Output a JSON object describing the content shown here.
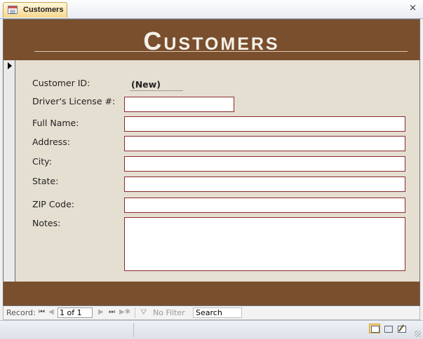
{
  "tab": {
    "label": "Customers",
    "close_glyph": "×"
  },
  "form": {
    "title": "Customers",
    "fields": [
      {
        "label": "Customer ID:",
        "value": "(New)"
      },
      {
        "label": "Driver's License #:",
        "value": ""
      },
      {
        "label": "Full Name:",
        "value": ""
      },
      {
        "label": "Address:",
        "value": ""
      },
      {
        "label": "City:",
        "value": ""
      },
      {
        "label": "State:",
        "value": ""
      },
      {
        "label": "ZIP Code:",
        "value": ""
      },
      {
        "label": "Notes:",
        "value": ""
      }
    ]
  },
  "navbar": {
    "record_label": "Record:",
    "first": "⏮",
    "prev": "◀",
    "current": "1 of 1",
    "next": "▶",
    "last": "⏭",
    "new": "▶✱",
    "filter_icon": "funnel-icon",
    "filter_label": "No Filter",
    "search_value": "Search"
  },
  "statusbar": {
    "views": [
      "form-view-icon",
      "layout-view-icon",
      "design-view-icon"
    ]
  },
  "colors": {
    "header_brown": "#7a4f2e",
    "form_background": "#e5dfd2",
    "field_border": "#8b2b2b"
  }
}
